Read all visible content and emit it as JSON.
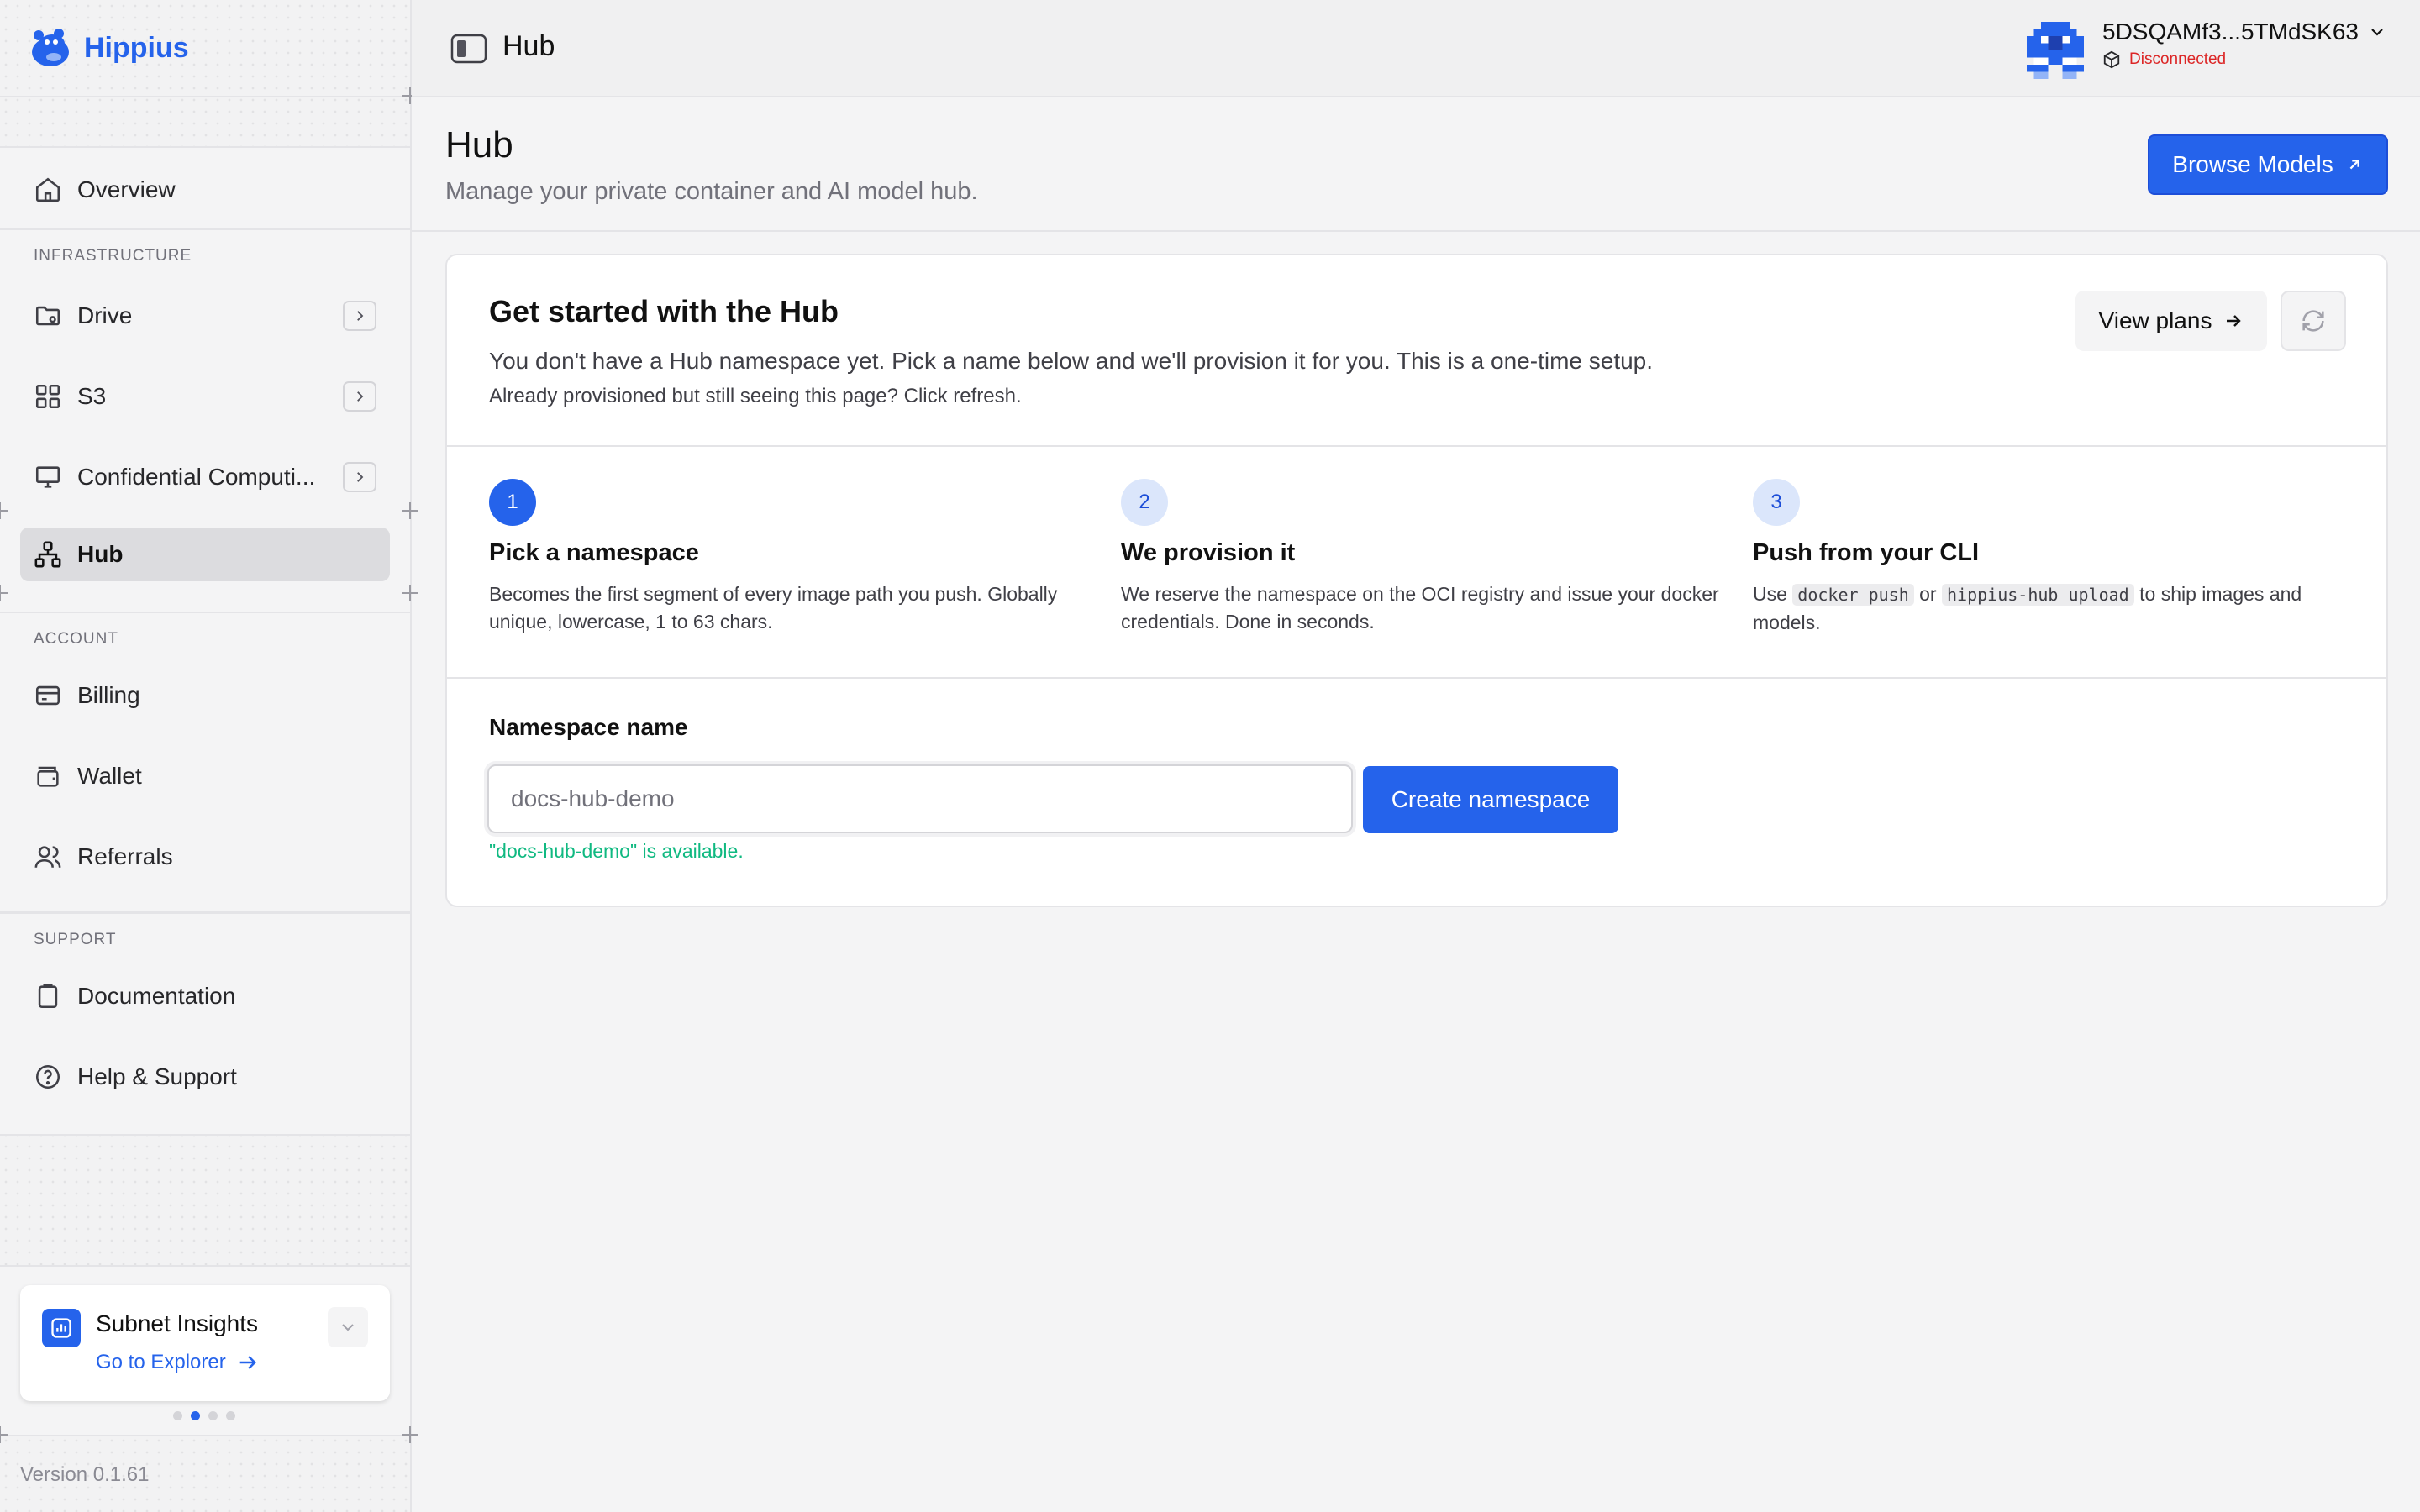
{
  "app": {
    "name": "Hippius",
    "version": "Version 0.1.61"
  },
  "sidebar": {
    "overview": "Overview",
    "sections": {
      "infrastructure": "INFRASTRUCTURE",
      "account": "ACCOUNT",
      "support": "SUPPORT"
    },
    "items": {
      "drive": "Drive",
      "s3": "S3",
      "compute": "Confidential Computi...",
      "hub": "Hub",
      "billing": "Billing",
      "wallet": "Wallet",
      "referrals": "Referrals",
      "documentation": "Documentation",
      "help": "Help & Support"
    },
    "active": "hub",
    "insights": {
      "title": "Subnet Insights",
      "link": "Go to Explorer"
    },
    "carousel": {
      "count": 4,
      "active": 1
    }
  },
  "topbar": {
    "title": "Hub",
    "account_id": "5DSQAMf3...5TMdSK63",
    "status": "Disconnected"
  },
  "header": {
    "title": "Hub",
    "subtitle": "Manage your private container and AI model hub.",
    "browse_button": "Browse Models"
  },
  "card": {
    "title": "Get started with the Hub",
    "description": "You don't have a Hub namespace yet. Pick a name below and we'll provision it for you. This is a one-time setup.",
    "hint": "Already provisioned but still seeing this page? Click refresh.",
    "plans_button": "View plans",
    "steps": [
      {
        "num": "1",
        "title": "Pick a namespace",
        "desc": "Becomes the first segment of every image path you push. Globally unique, lowercase, 1 to 63 chars."
      },
      {
        "num": "2",
        "title": "We provision it",
        "desc": "We reserve the namespace on the OCI registry and issue your docker credentials. Done in seconds."
      },
      {
        "num": "3",
        "title": "Push from your CLI",
        "desc_pre": "Use",
        "code1": "docker push",
        "desc_mid": "or",
        "code2": "hippius-hub upload",
        "desc_post": "to ship images and models."
      }
    ],
    "form": {
      "label": "Namespace name",
      "placeholder": "docs-hub-demo",
      "value": "",
      "create_button": "Create namespace",
      "availability": "\"docs-hub-demo\" is available."
    }
  },
  "colors": {
    "accent": "#2563eb",
    "success": "#10b981",
    "danger": "#dc2626"
  }
}
